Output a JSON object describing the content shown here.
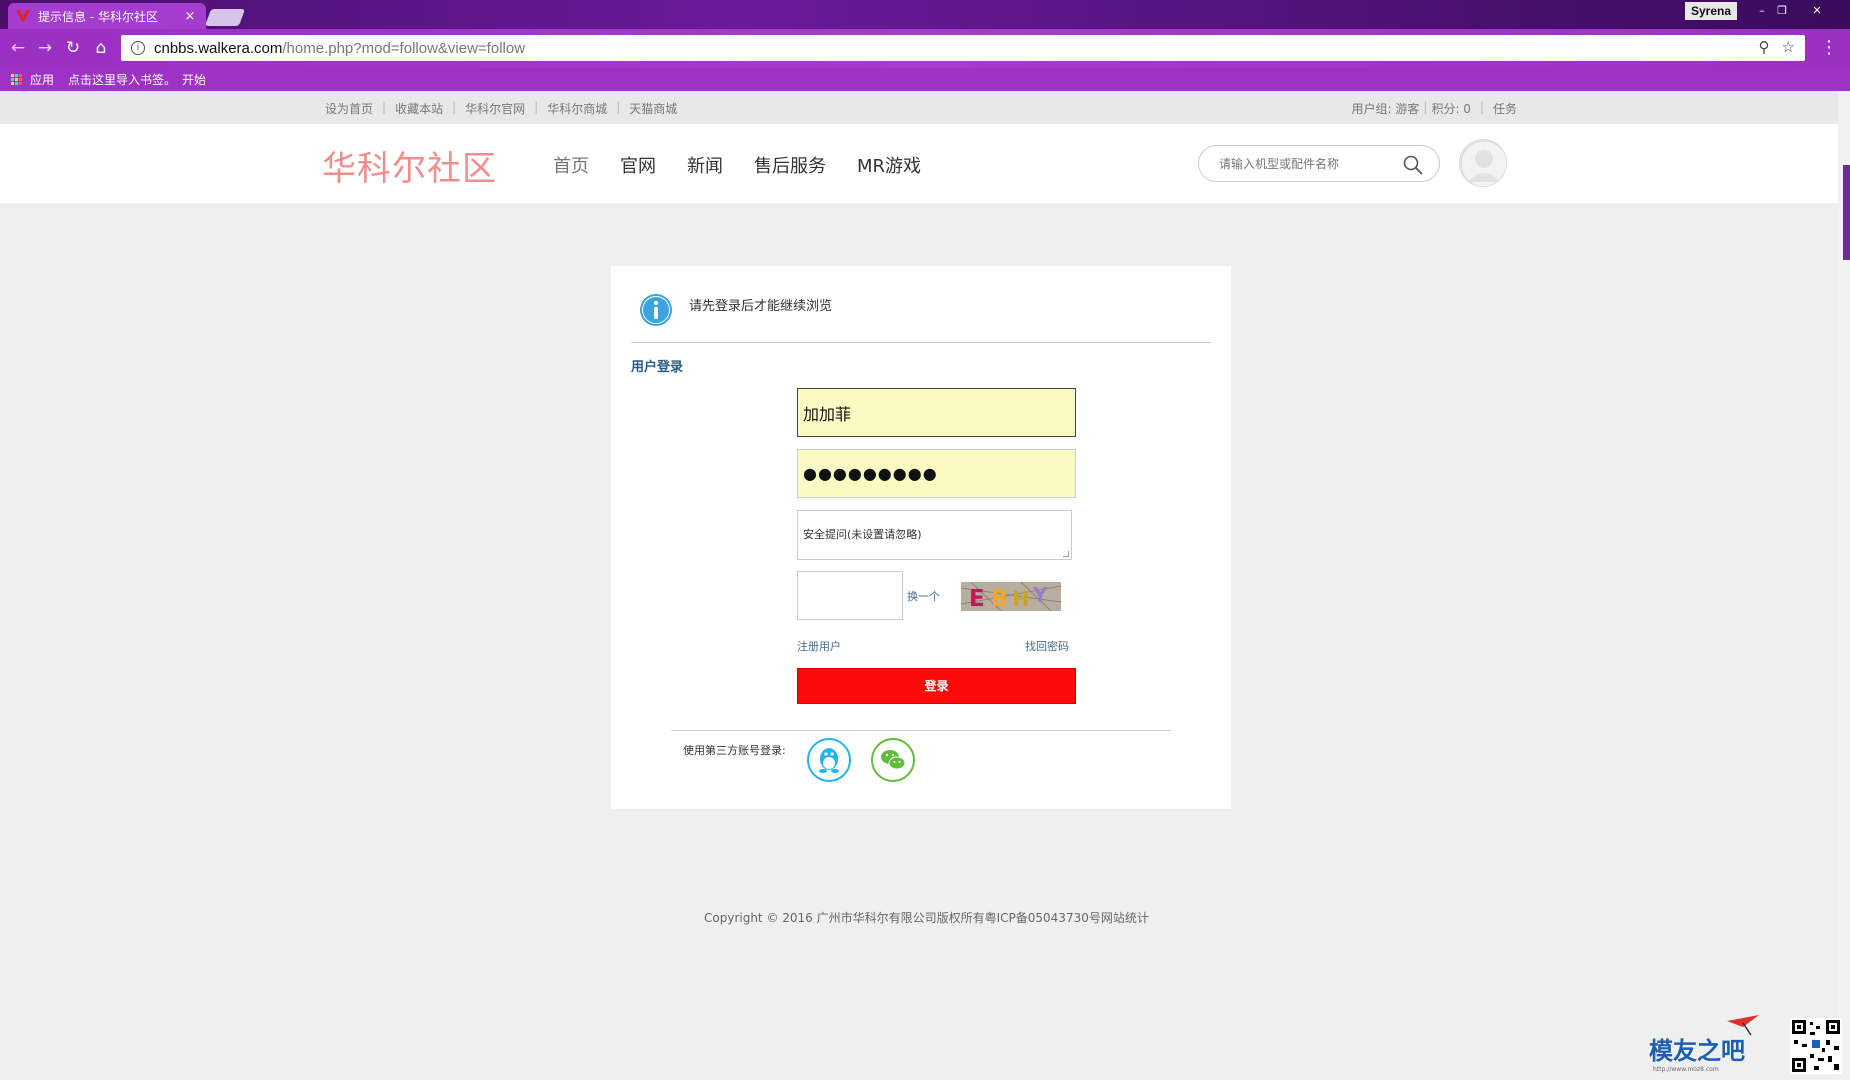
{
  "browser": {
    "tab_title": "提示信息 - 华科尔社区",
    "tab_close": "×",
    "profile_name": "Syrena",
    "window_controls": {
      "minimize": "–",
      "maximize": "❐",
      "close": "✕"
    },
    "url_host": "cnbbs.walkera.com",
    "url_path": "/home.php?mod=follow&view=follow",
    "bookmarks": {
      "apps_label": "应用",
      "import_label": "点击这里导入书签。",
      "start_label": "开始"
    }
  },
  "topbar": {
    "left_links": [
      "设为首页",
      "收藏本站",
      "华科尔官网",
      "华科尔商城",
      "天猫商城"
    ],
    "user_group": "用户组: 游客",
    "points": "积分: 0",
    "tasks": "任务"
  },
  "header": {
    "logo_text": "华科尔社区",
    "nav": [
      "首页",
      "官网",
      "新闻",
      "售后服务",
      "MR游戏"
    ],
    "search_placeholder": "请输入机型或配件名称"
  },
  "login": {
    "notice": "请先登录后才能继续浏览",
    "section_title": "用户登录",
    "username_value": "加加菲",
    "password_value": "●●●●●●●●●",
    "security_question": "安全提问(未设置请忽略)",
    "captcha_refresh": "换一个",
    "captcha_text": "EBHY",
    "register_link": "注册用户",
    "forgot_link": "找回密码",
    "submit_label": "登录",
    "third_party_label": "使用第三方账号登录:"
  },
  "footer": {
    "copyright": "Copyright © 2016 广州市华科尔有限公司版权所有粤ICP备05043730号网站统计"
  },
  "watermark": {
    "logo_text": "模友之吧",
    "logo_url": "http://www.moz8.com"
  },
  "colors": {
    "browser_accent": "#a43ccf",
    "logo": "#f08d8d",
    "login_button": "#ff0a0a",
    "autofill": "#fafac2",
    "qq": "#1fb4ee",
    "wechat": "#5fbd3a"
  }
}
